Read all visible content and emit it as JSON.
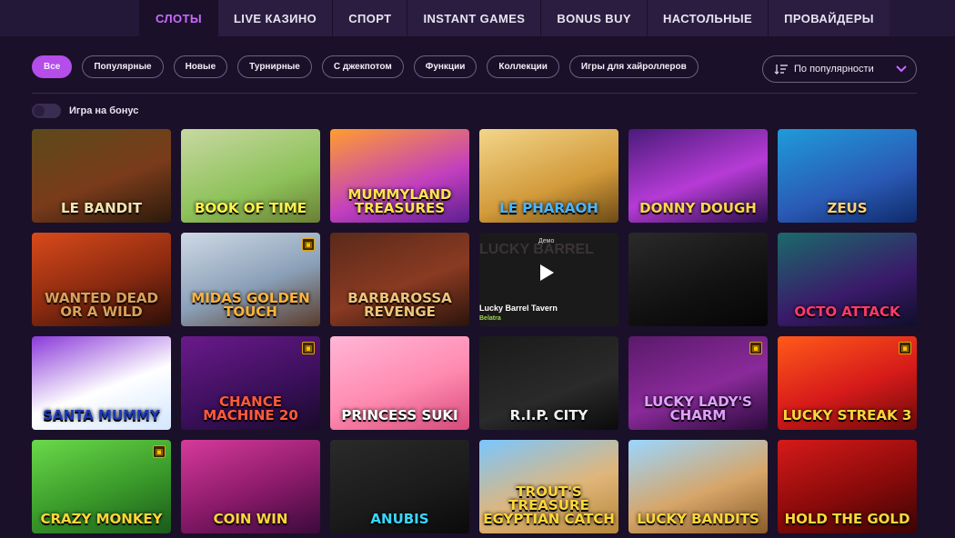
{
  "nav": {
    "tabs": [
      {
        "label": "СЛОТЫ",
        "active": true
      },
      {
        "label": "LIVE КАЗИНО"
      },
      {
        "label": "СПОРТ"
      },
      {
        "label": "INSTANT GAMES"
      },
      {
        "label": "BONUS BUY"
      },
      {
        "label": "НАСТОЛЬНЫЕ"
      },
      {
        "label": "ПРОВАЙДЕРЫ"
      }
    ]
  },
  "filters": {
    "chips": [
      "Все",
      "Популярные",
      "Новые",
      "Турнирные",
      "С джекпотом",
      "Функции",
      "Коллекции",
      "Игры для хайроллеров"
    ],
    "active_index": 0,
    "sort_label": "По популярности"
  },
  "bonus_toggle": {
    "label": "Игра на бонус",
    "on": false
  },
  "games": [
    {
      "title": "LE BANDIT",
      "bg": "linear-gradient(160deg,#5c4a1a,#7a3b1b 55%,#2b1a0c)",
      "color": "#f3e3b0"
    },
    {
      "title": "BOOK OF TIME",
      "bg": "linear-gradient(160deg,#c8d8a2,#8ec25a 60%,#6a7f35)",
      "color": "#fff34a"
    },
    {
      "title": "MUMMYLAND TREASURES",
      "bg": "linear-gradient(160deg,#ff9d2f,#c23fbf 60%,#5b1f8f)",
      "color": "#ffe44d"
    },
    {
      "title": "LE PHARAOH",
      "bg": "linear-gradient(160deg,#f3d58a,#d29a3a 60%,#6c4a16)",
      "color": "#48b6ff"
    },
    {
      "title": "DONNY DOUGH",
      "bg": "linear-gradient(160deg,#4a1b7a,#b63bd6 55%,#2a0f4a)",
      "color": "#ffd54d"
    },
    {
      "title": "ZEUS",
      "bg": "linear-gradient(160deg,#1f9bd9,#2a5ab6 60%,#0f2a6a)",
      "color": "#ffd27a"
    },
    {
      "title": "WANTED DEAD OR A WILD",
      "bg": "linear-gradient(160deg,#d94a1a,#8a2a10 55%,#2a0f08)",
      "color": "#d9a15a"
    },
    {
      "title": "MIDAS GOLDEN TOUCH",
      "bg": "linear-gradient(160deg,#cfd9e6,#8aa0b8 55%,#5a3b2a)",
      "color": "#ffb43a",
      "gift": true
    },
    {
      "title": "BARBAROSSA REVENGE",
      "bg": "linear-gradient(160deg,#5a2a1a,#8a3a22 55%,#2a140c)",
      "color": "#f0c47a"
    },
    {
      "hover": true,
      "demo": "Демо",
      "name": "Lucky Barrel Tavern",
      "provider": "Belatra",
      "ghost": "LUCKY BARREL"
    },
    {
      "title": "",
      "bg": "linear-gradient(160deg,#2a2a2a,#111111 60%,#050505)",
      "color": "#4ad6a6"
    },
    {
      "title": "OCTO ATTACK",
      "bg": "linear-gradient(160deg,#1a6a6a,#3a1a6a 60%,#0f0f2a)",
      "color": "#ff3a6a"
    },
    {
      "title": "SANTA MUMMY",
      "bg": "linear-gradient(160deg,#8a3ad9,#ffffff 55%,#d4e6ff)",
      "color": "#1a3ab6"
    },
    {
      "title": "CHANCE MACHINE 20",
      "bg": "linear-gradient(160deg,#6a1a8a,#3a0f5a 60%,#1a0a2a)",
      "color": "#ff5a3a",
      "gift": true
    },
    {
      "title": "PRINCESS SUKI",
      "bg": "linear-gradient(160deg,#ffb6d6,#ff8ab0 55%,#d64a7a)",
      "color": "#ffffff"
    },
    {
      "title": "R.I.P. CITY",
      "bg": "linear-gradient(160deg,#1a1a1a,#2a2a2a 60%,#0a0a0a)",
      "color": "#f0f0f0"
    },
    {
      "title": "LUCKY LADY'S CHARM",
      "bg": "linear-gradient(160deg,#5a1a6a,#8a2a9a 55%,#2a0a3a)",
      "color": "#e0a0ff",
      "gift": true
    },
    {
      "title": "LUCKY STREAK 3",
      "bg": "linear-gradient(160deg,#ff5a1a,#d61a1a 55%,#6a0a0a)",
      "color": "#ffd63a",
      "gift": true
    },
    {
      "title": "CRAZY MONKEY",
      "bg": "linear-gradient(160deg,#6ad94a,#3a9a2a 55%,#1a5a1a)",
      "color": "#ffd63a",
      "gift": true
    },
    {
      "title": "COIN WIN",
      "bg": "linear-gradient(160deg,#d63a9a,#8a1a6a 55%,#3a0a3a)",
      "color": "#ffd63a"
    },
    {
      "title": "ANUBIS",
      "bg": "linear-gradient(160deg,#2a2a2a,#1a1a1a 60%,#0a0a0a)",
      "color": "#3ad6ff"
    },
    {
      "title": "TROUT'S TREASURE EGYPTIAN CATCH",
      "bg": "linear-gradient(160deg,#7ac6ff,#e0b67a 55%,#b6863a)",
      "color": "#ffd63a"
    },
    {
      "title": "LUCKY BANDITS",
      "bg": "linear-gradient(160deg,#9ad6ff,#d6a66a 55%,#8a5a2a)",
      "color": "#ffd63a"
    },
    {
      "title": "HOLD THE GOLD",
      "bg": "linear-gradient(160deg,#d61a1a,#8a0a0a 55%,#3a0505)",
      "color": "#ffd63a"
    }
  ]
}
